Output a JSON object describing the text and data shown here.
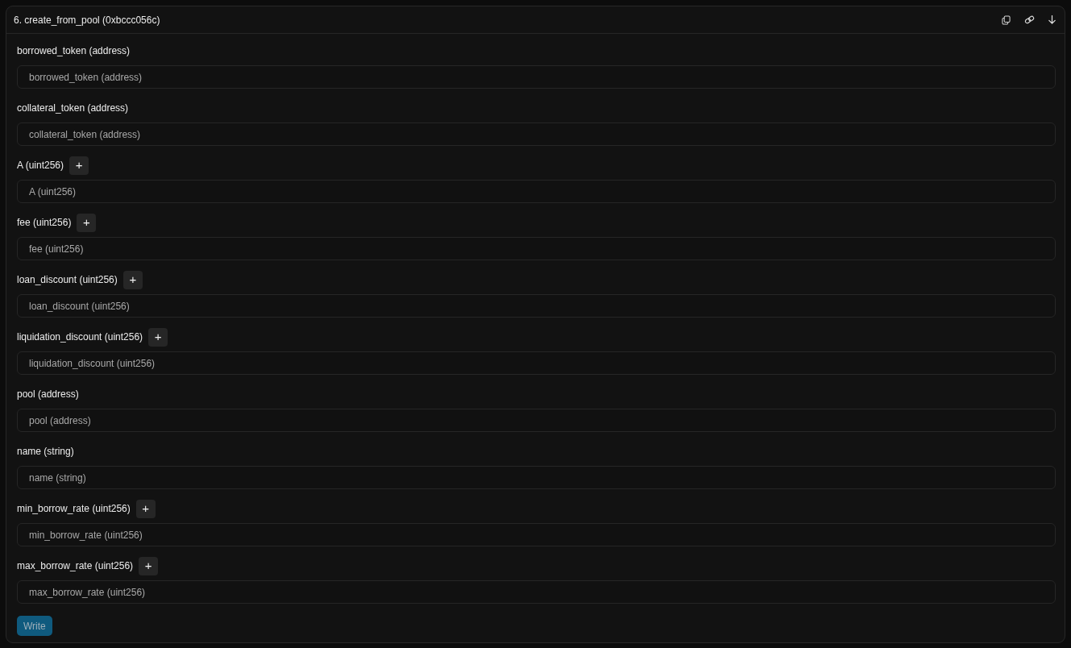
{
  "panel": {
    "title": "6. create_from_pool (0xbccc056c)"
  },
  "params": [
    {
      "kind": "text",
      "label": "borrowed_token (address)",
      "placeholder": "borrowed_token (address)"
    },
    {
      "kind": "text",
      "label": "collateral_token (address)",
      "placeholder": "collateral_token (address)"
    },
    {
      "kind": "number",
      "label": "A (uint256)",
      "add_label": "+",
      "placeholder": "A (uint256)"
    },
    {
      "kind": "number",
      "label": "fee (uint256)",
      "add_label": "+",
      "placeholder": "fee (uint256)"
    },
    {
      "kind": "number",
      "label": "loan_discount (uint256)",
      "add_label": "+",
      "placeholder": "loan_discount (uint256)"
    },
    {
      "kind": "number",
      "label": "liquidation_discount (uint256)",
      "add_label": "+",
      "placeholder": "liquidation_discount (uint256)"
    },
    {
      "kind": "text",
      "label": "pool (address)",
      "placeholder": "pool (address)"
    },
    {
      "kind": "text",
      "label": "name (string)",
      "placeholder": "name (string)"
    },
    {
      "kind": "number",
      "label": "min_borrow_rate (uint256)",
      "add_label": "+",
      "placeholder": "min_borrow_rate (uint256)"
    },
    {
      "kind": "number",
      "label": "max_borrow_rate (uint256)",
      "add_label": "+",
      "placeholder": "max_borrow_rate (uint256)"
    }
  ],
  "submit": {
    "label": "Write",
    "disabled": true
  }
}
